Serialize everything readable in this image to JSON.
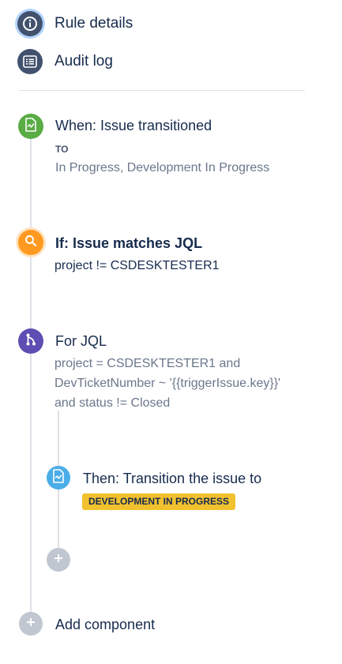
{
  "nav": {
    "rule_details": "Rule details",
    "audit_log": "Audit log"
  },
  "trigger": {
    "title": "When: Issue transitioned",
    "to_label": "TO",
    "value": "In Progress, Development In Progress"
  },
  "condition": {
    "title": "If: Issue matches JQL",
    "value": "project != CSDESKTESTER1"
  },
  "branch": {
    "title": "For JQL",
    "lines": [
      "project = CSDESKTESTER1 and",
      "DevTicketNumber ~ '{{triggerIssue.key}}'",
      "and status != Closed"
    ]
  },
  "action": {
    "title": "Then: Transition the issue to",
    "status": "DEVELOPMENT IN PROGRESS"
  },
  "footer": {
    "add_component": "Add component"
  },
  "colors": {
    "nav": "#42526e",
    "trigger": "#5aac44",
    "condition": "#ff991f",
    "branch": "#5e4db2",
    "action": "#4bade8",
    "add": "#c1c7d0",
    "lozenge": "#f2c12e"
  }
}
